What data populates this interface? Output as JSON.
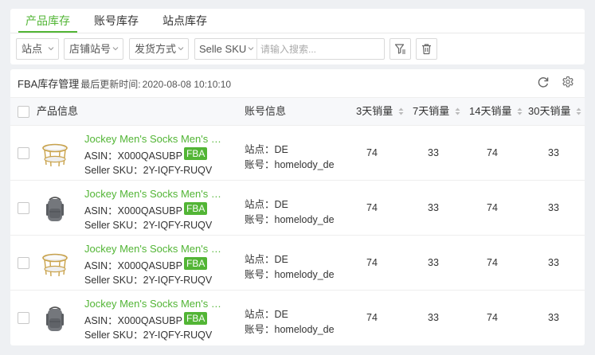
{
  "tabs": [
    {
      "label": "产品库存",
      "active": true
    },
    {
      "label": "账号库存",
      "active": false
    },
    {
      "label": "站点库存",
      "active": false
    }
  ],
  "filters": {
    "site": "站点",
    "store": "店铺站号",
    "shipping": "发货方式",
    "search_field": "Selle SKU",
    "search_placeholder": "请输入搜索..."
  },
  "header": {
    "title": "FBA库存管理",
    "updated_label": "最后更新时间:",
    "updated_time": "2020-08-08 10:10:10"
  },
  "columns": {
    "product": "产品信息",
    "account": "账号信息",
    "sales_3d": "3天销量",
    "sales_7d": "7天销量",
    "sales_14d": "14天销量",
    "sales_30d": "30天销量"
  },
  "rows": [
    {
      "thumb": "table",
      "name": "Jockey Men's Socks Men's Cushion Quarter Socks",
      "asin": "ASIN：X000QASUBP",
      "badge": "FBA",
      "sku": "Seller SKU：2Y-IQFY-RUQV",
      "site": "站点：DE",
      "account": "账号：homelody_de",
      "s3": "74",
      "s7": "33",
      "s14": "74",
      "s30": "33"
    },
    {
      "thumb": "backpack",
      "name": "Jockey Men's Socks Men's Cushion Quarter Socks",
      "asin": "ASIN：X000QASUBP",
      "badge": "FBA",
      "sku": "Seller SKU：2Y-IQFY-RUQV",
      "site": "站点：DE",
      "account": "账号：homelody_de",
      "s3": "74",
      "s7": "33",
      "s14": "74",
      "s30": "33"
    },
    {
      "thumb": "table",
      "name": "Jockey Men's Socks Men's Cushion Quarter Socks",
      "asin": "ASIN：X000QASUBP",
      "badge": "FBA",
      "sku": "Seller SKU：2Y-IQFY-RUQV",
      "site": "站点：DE",
      "account": "账号：homelody_de",
      "s3": "74",
      "s7": "33",
      "s14": "74",
      "s30": "33"
    },
    {
      "thumb": "backpack",
      "name": "Jockey Men's Socks Men's Cushion Quarter Socks",
      "asin": "ASIN：X000QASUBP",
      "badge": "FBA",
      "sku": "Seller SKU：2Y-IQFY-RUQV",
      "site": "站点：DE",
      "account": "账号：homelody_de",
      "s3": "74",
      "s7": "33",
      "s14": "74",
      "s30": "33"
    }
  ],
  "icons": {
    "filter": "filter-icon",
    "delete": "trash-icon",
    "refresh": "refresh-icon",
    "settings": "gear-icon"
  },
  "colors": {
    "accent": "#52b535"
  }
}
